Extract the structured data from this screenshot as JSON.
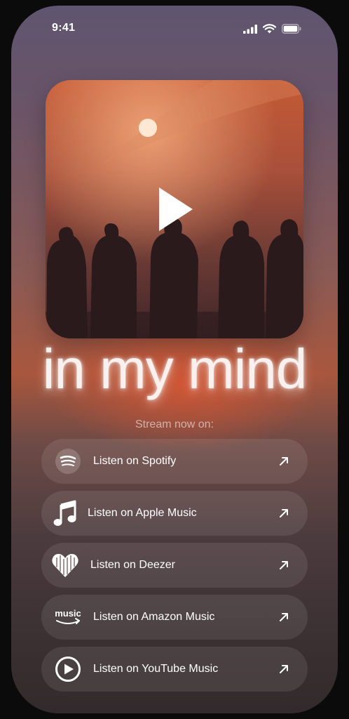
{
  "status_bar": {
    "time": "9:41"
  },
  "song": {
    "title": "in my mind"
  },
  "stream_label": "Stream now on:",
  "links": [
    {
      "label": "Listen on Spotify",
      "icon": "spotify-icon"
    },
    {
      "label": "Listen on Apple Music",
      "icon": "apple-music-icon"
    },
    {
      "label": "Listen on Deezer",
      "icon": "deezer-icon"
    },
    {
      "label": "Listen on Amazon Music",
      "icon": "amazon-music-icon"
    },
    {
      "label": "Listen on YouTube Music",
      "icon": "youtube-music-icon"
    }
  ],
  "amazon_icon_text": "music",
  "colors": {
    "accent": "#d9573a",
    "background": "#0b0b0c"
  }
}
